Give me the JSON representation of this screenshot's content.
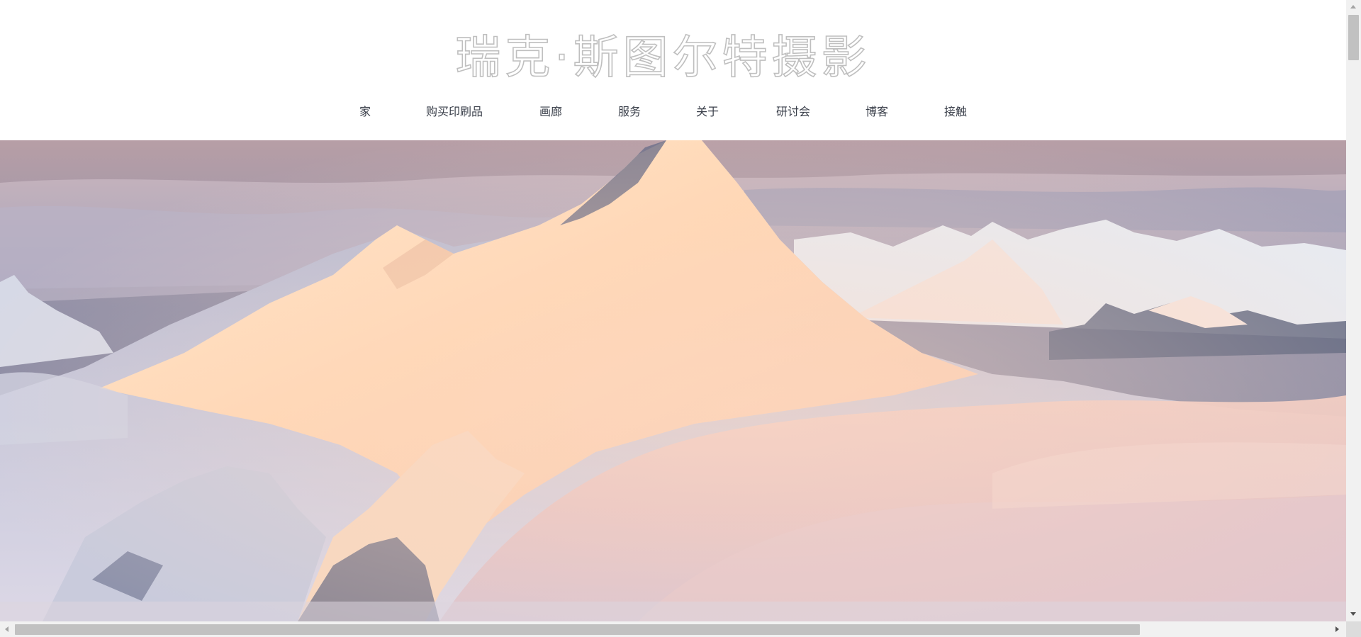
{
  "site": {
    "title": "瑞克·斯图尔特摄影"
  },
  "nav": {
    "items": [
      {
        "label": "家"
      },
      {
        "label": "购买印刷品"
      },
      {
        "label": "画廊"
      },
      {
        "label": "服务"
      },
      {
        "label": "关于"
      },
      {
        "label": "研讨会"
      },
      {
        "label": "博客"
      },
      {
        "label": "接触"
      }
    ]
  },
  "colors": {
    "nav_text": "#3a3f4a",
    "title_outline": "#bfbfbf",
    "background": "#ffffff"
  }
}
